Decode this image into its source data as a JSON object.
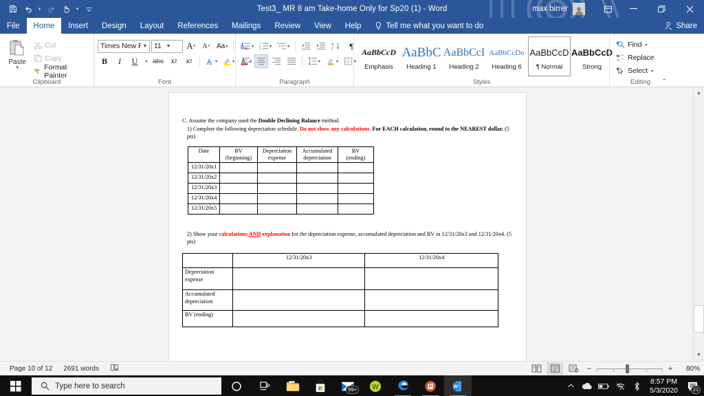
{
  "titlebar": {
    "document_title": "Test3_ MR 8 am Take-home Only for Sp20 (1)  -  Word",
    "user_name": "max birrer",
    "qat": [
      {
        "name": "save-button",
        "icon": "save-icon"
      },
      {
        "name": "undo-button",
        "icon": "undo-icon"
      },
      {
        "name": "redo-button",
        "icon": "redo-icon"
      },
      {
        "name": "touch-mode-button",
        "icon": "touch-mode-icon"
      },
      {
        "name": "customize-qat-button",
        "icon": "chevron-down-icon"
      }
    ],
    "window_buttons": {
      "ribbon_display": "ribbon-display-options-icon",
      "minimize": "minimize-icon",
      "restore": "restore-icon",
      "close": "close-icon"
    }
  },
  "tabs": [
    {
      "label": "File",
      "active": false
    },
    {
      "label": "Home",
      "active": true
    },
    {
      "label": "Insert",
      "active": false
    },
    {
      "label": "Design",
      "active": false
    },
    {
      "label": "Layout",
      "active": false
    },
    {
      "label": "References",
      "active": false
    },
    {
      "label": "Mailings",
      "active": false
    },
    {
      "label": "Review",
      "active": false
    },
    {
      "label": "View",
      "active": false
    },
    {
      "label": "Help",
      "active": false
    }
  ],
  "tell_me": {
    "label": "Tell me what you want to do"
  },
  "share": {
    "label": "Share"
  },
  "ribbon": {
    "clipboard": {
      "group_label": "Clipboard",
      "paste_label": "Paste",
      "items": [
        {
          "label": "Cut",
          "enabled": false
        },
        {
          "label": "Copy",
          "enabled": false
        },
        {
          "label": "Format Painter",
          "enabled": true
        }
      ]
    },
    "font": {
      "group_label": "Font",
      "font_name": "Times New R",
      "font_size": "11",
      "buttons": [
        "grow-font-icon",
        "shrink-font-icon",
        "change-case-icon",
        "clear-formatting-icon",
        "bold-icon",
        "italic-icon",
        "underline-icon",
        "strikethrough-icon",
        "subscript-icon",
        "superscript-icon",
        "text-effects-icon",
        "text-highlight-color-icon",
        "font-color-icon"
      ]
    },
    "paragraph": {
      "group_label": "Paragraph",
      "buttons": [
        "bullets-icon",
        "numbering-icon",
        "multilevel-list-icon",
        "decrease-indent-icon",
        "increase-indent-icon",
        "sort-icon",
        "show-formatting-marks-icon",
        "align-left-icon",
        "align-center-icon",
        "align-right-icon",
        "justify-icon",
        "line-spacing-icon",
        "shading-icon",
        "borders-icon"
      ],
      "active_alignment": "align-center-icon"
    },
    "styles": {
      "group_label": "Styles",
      "items": [
        {
          "name": "Emphasis",
          "preview": "AaBbCcD",
          "selected": false
        },
        {
          "name": "Heading 1",
          "preview": "AaBbC",
          "selected": false
        },
        {
          "name": "Heading 2",
          "preview": "AaBbCcI",
          "selected": false
        },
        {
          "name": "Heading 6",
          "preview": "AaBbCcDo",
          "selected": false
        },
        {
          "name": "¶ Normal",
          "preview": "AaBbCcD",
          "selected": true
        },
        {
          "name": "Strong",
          "preview": "AaBbCcD",
          "selected": false
        }
      ]
    },
    "editing": {
      "group_label": "Editing",
      "items": [
        {
          "label": "Find",
          "icon": "search-icon"
        },
        {
          "label": "Replace",
          "icon": "replace-icon"
        },
        {
          "label": "Select",
          "icon": "select-icon"
        }
      ]
    }
  },
  "document": {
    "para_c_prefix": "C. Assume the company used the ",
    "para_c_bold": "Double Declining Balance",
    "para_c_suffix": " method.",
    "para_1_prefix": "1) Complete the following depreciation schedule. ",
    "para_1_red": "Do not show any calculations.",
    "para_1_bold": " For EACH calculation, round to the NEAREST dollar.",
    "para_1_suffix": " (5 pts)",
    "table1": {
      "headers": [
        {
          "line1": "Date",
          "line2": ""
        },
        {
          "line1": "BV",
          "line2": "(beginning)"
        },
        {
          "line1": "Depreciation",
          "line2": "expense"
        },
        {
          "line1": "Accumulated",
          "line2": "depreciation"
        },
        {
          "line1": "BV",
          "line2": "(ending)"
        }
      ],
      "rows": [
        [
          "12/31/20x1",
          "",
          "",
          "",
          ""
        ],
        [
          "12/31/20x2",
          "",
          "",
          "",
          ""
        ],
        [
          "12/31/20x3",
          "",
          "",
          "",
          ""
        ],
        [
          "12/31/20x4",
          "",
          "",
          "",
          ""
        ],
        [
          "12/31/20x5",
          "",
          "",
          "",
          ""
        ]
      ]
    },
    "para_2_prefix": "2) Show your ",
    "para_2_red1": "calculations ",
    "para_2_red_underline": "AND",
    "para_2_red2": " explanation",
    "para_2_suffix": " for the depreciation expense, accumulated depreciation and BV in 12/31/20x3 and 12/31/20x4. (5 pts)",
    "table2": {
      "headers": [
        "",
        "12/31/20x3",
        "12/31/20x4"
      ],
      "rows": [
        [
          "Depreciation expense",
          "",
          ""
        ],
        [
          "Accumulated depreciation",
          "",
          ""
        ],
        [
          "BV (ending)",
          "",
          ""
        ]
      ]
    }
  },
  "statusbar": {
    "page": "Page 10 of 12",
    "words": "2691 words",
    "proofing_icon": "proofing-errors-icon",
    "views": [
      {
        "name": "read-mode-view-button",
        "active": false
      },
      {
        "name": "print-layout-view-button",
        "active": true
      },
      {
        "name": "web-layout-view-button",
        "active": false
      }
    ],
    "zoom_out": "−",
    "zoom_in": "+",
    "zoom_level": "80%"
  },
  "taskbar": {
    "search_placeholder": "Type here to search",
    "items": [
      {
        "name": "cortana-button",
        "icon": "cortana-icon"
      },
      {
        "name": "task-view-button",
        "icon": "task-view-icon"
      },
      {
        "name": "file-explorer-button",
        "icon": "file-explorer-icon"
      },
      {
        "name": "microsoft-store-button",
        "icon": "store-icon"
      },
      {
        "name": "mail-button",
        "icon": "mail-icon",
        "badge": "99+"
      },
      {
        "name": "wps-office-button",
        "icon": "w-circle-icon"
      },
      {
        "name": "microsoft-edge-button",
        "icon": "edge-icon"
      },
      {
        "name": "powerpoint-button",
        "icon": "powerpoint-icon"
      },
      {
        "name": "word-button",
        "icon": "word-icon",
        "active": true
      }
    ],
    "tray": [
      {
        "name": "show-hidden-icons-button",
        "icon": "chevron-up-icon"
      },
      {
        "name": "onedrive-tray-icon",
        "icon": "cloud-icon"
      },
      {
        "name": "battery-tray-icon",
        "icon": "battery-icon"
      },
      {
        "name": "network-tray-icon",
        "icon": "wifi-icon"
      },
      {
        "name": "bluetooth-tray-icon",
        "icon": "bluetooth-icon"
      }
    ],
    "clock_time": "8:57 PM",
    "clock_date": "5/3/2020",
    "notification_count": "21"
  }
}
